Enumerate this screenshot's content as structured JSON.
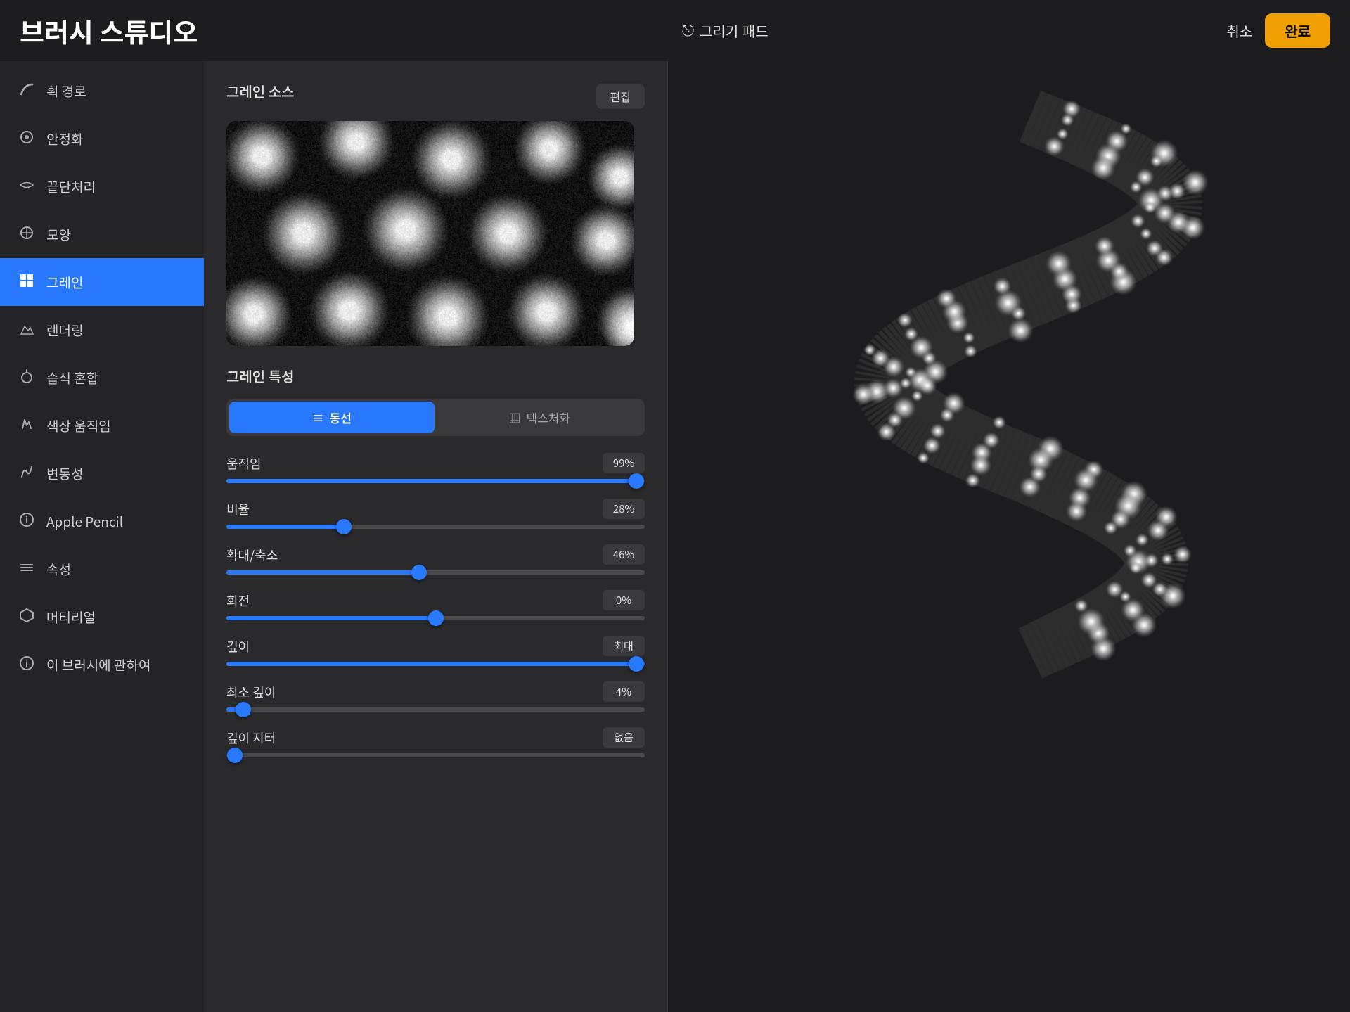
{
  "header": {
    "title": "브러시 스튜디오",
    "drawing_pad_label": "그리기 패드",
    "cancel_label": "취소",
    "done_label": "완료"
  },
  "sidebar": {
    "items": [
      {
        "id": "stroke-path",
        "icon": "↩",
        "label": "획 경로",
        "active": false
      },
      {
        "id": "stabilize",
        "icon": "⊙",
        "label": "안정화",
        "active": false
      },
      {
        "id": "taper",
        "icon": "〜",
        "label": "끝단처리",
        "active": false
      },
      {
        "id": "shape",
        "icon": "✿",
        "label": "모양",
        "active": false
      },
      {
        "id": "grain",
        "icon": "⊞",
        "label": "그레인",
        "active": true
      },
      {
        "id": "rendering",
        "icon": "✏",
        "label": "렌더링",
        "active": false
      },
      {
        "id": "wet-mix",
        "icon": "💧",
        "label": "습식 혼합",
        "active": false
      },
      {
        "id": "color-dynamics",
        "icon": "⚙",
        "label": "색상 움직임",
        "active": false
      },
      {
        "id": "variation",
        "icon": "↻",
        "label": "변동성",
        "active": false
      },
      {
        "id": "apple-pencil",
        "icon": "ℹ",
        "label": "Apple Pencil",
        "active": false
      },
      {
        "id": "properties",
        "icon": "≡",
        "label": "속성",
        "active": false
      },
      {
        "id": "material",
        "icon": "◎",
        "label": "머티리얼",
        "active": false
      },
      {
        "id": "about",
        "icon": "ℹ",
        "label": "이 브러시에 관하여",
        "active": false
      }
    ]
  },
  "panel": {
    "grain_source_label": "그레인 소스",
    "edit_label": "편집",
    "grain_properties_label": "그레인 특성",
    "tabs": [
      {
        "id": "motion",
        "icon": "≡",
        "label": "동선",
        "active": true
      },
      {
        "id": "texturize",
        "icon": "▦",
        "label": "텍스처화",
        "active": false
      }
    ],
    "sliders": [
      {
        "id": "movement",
        "label": "움직임",
        "value": 99,
        "unit": "%",
        "fill_pct": 99,
        "display": "99%"
      },
      {
        "id": "ratio",
        "label": "비율",
        "value": 28,
        "unit": "%",
        "fill_pct": 28,
        "display": "28%"
      },
      {
        "id": "zoom",
        "label": "확대/축소",
        "value": 46,
        "unit": "%",
        "fill_pct": 46,
        "display": "46%"
      },
      {
        "id": "rotation",
        "label": "회전",
        "value": 0,
        "unit": "%",
        "fill_pct": 50,
        "display": "0%"
      },
      {
        "id": "depth",
        "label": "깊이",
        "value": 100,
        "unit": "최대",
        "fill_pct": 100,
        "display": "최대"
      },
      {
        "id": "min-depth",
        "label": "최소 깊이",
        "value": 4,
        "unit": "%",
        "fill_pct": 4,
        "display": "4%"
      },
      {
        "id": "depth-jitter",
        "label": "깊이 지터",
        "value": 0,
        "unit": "없음",
        "fill_pct": 0,
        "display": "없음"
      }
    ]
  }
}
